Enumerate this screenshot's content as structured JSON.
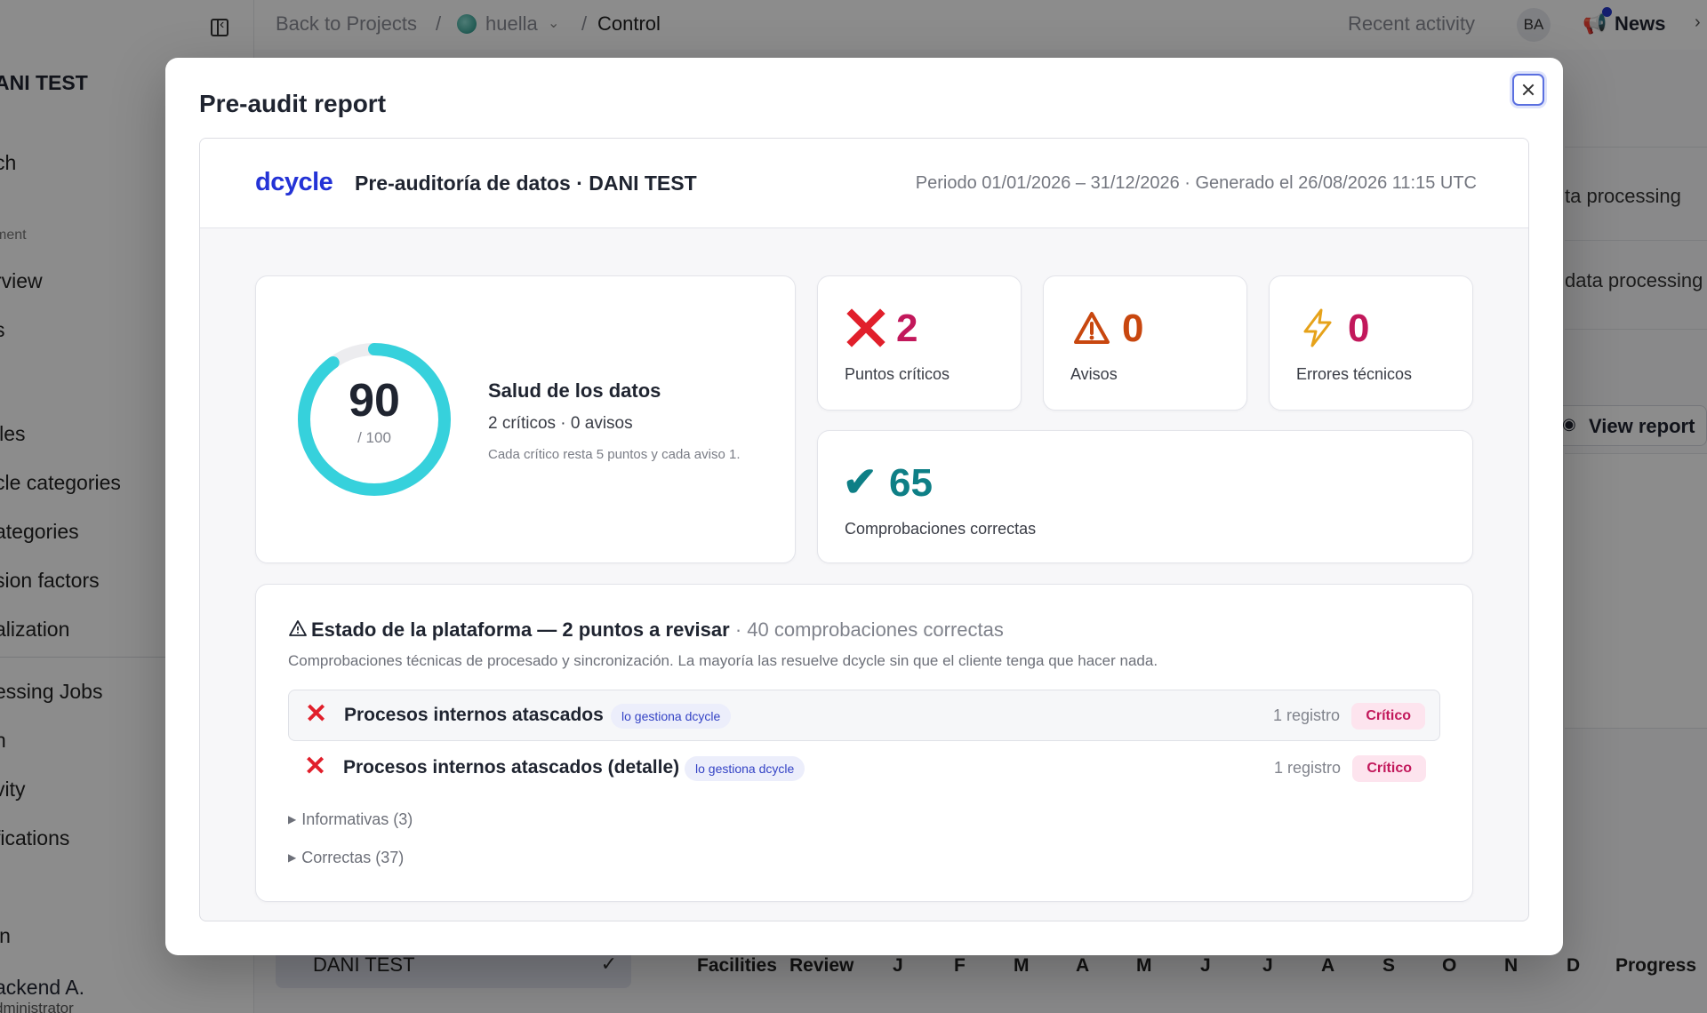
{
  "sidebar": {
    "org_title": "ANI TEST",
    "items_top": [
      {
        "label": "ch"
      }
    ],
    "section_label": "ment",
    "items_mid": [
      {
        "label": "rview"
      },
      {
        "label": "s"
      }
    ],
    "items_lists": [
      {
        "label": "iles"
      },
      {
        "label": "cle categories"
      },
      {
        "label": "ategories"
      },
      {
        "label": "sion factors"
      },
      {
        "label": "alization"
      }
    ],
    "items_bottom": [
      {
        "label": "essing Jobs"
      },
      {
        "label": "h"
      },
      {
        "label": "vity"
      },
      {
        "label": "fications"
      },
      {
        "label": "in"
      }
    ],
    "project": {
      "label": "DANI TEST"
    },
    "user": {
      "name": "ackend A.",
      "role": "dministrator"
    }
  },
  "topbar": {
    "back_label": "Back to Projects",
    "sep1": "/",
    "project_name": "huella",
    "sep2": "/",
    "current": "Control",
    "recent_activity": "Recent activity",
    "avatar_initials": "BA",
    "news_label": "News"
  },
  "background": {
    "row1": "ta processing",
    "row2": "data processing",
    "view_report": "View report",
    "table_headers": [
      "Facilities",
      "Review",
      "J",
      "F",
      "M",
      "A",
      "M",
      "J",
      "J",
      "A",
      "S",
      "O",
      "N",
      "D",
      "Progress"
    ]
  },
  "modal": {
    "title": "Pre-audit report",
    "report": {
      "brand": "dcycle",
      "title": "Pre-auditoría de datos · DANI TEST",
      "meta": "Periodo 01/01/2026 – 31/12/2026 · Generado el 26/08/2026 11:15 UTC",
      "health": {
        "score": "90",
        "score_max": "/ 100",
        "score_fraction": 0.9,
        "title": "Salud de los datos",
        "summary": "2 críticos · 0 avisos",
        "note": "Cada crítico resta 5 puntos y cada aviso 1."
      },
      "stats": {
        "critical": {
          "value": "2",
          "label": "Puntos críticos",
          "color": "#c2185b",
          "icon": "x-icon"
        },
        "warnings": {
          "value": "0",
          "label": "Avisos",
          "color": "#c8470f",
          "icon": "warning-icon"
        },
        "errors": {
          "value": "0",
          "label": "Errores técnicos",
          "color": "#c2185b",
          "icon": "lightning-icon"
        },
        "ok": {
          "value": "65",
          "label": "Comprobaciones correctas",
          "color": "#0e7f86",
          "icon": "check-icon"
        }
      },
      "platform": {
        "heading": "Estado de la plataforma — 2 puntos a revisar",
        "heading_extra": "· 40 comprobaciones correctas",
        "description": "Comprobaciones técnicas de procesado y sincronización. La mayoría las resuelve dcycle sin que el cliente tenga que hacer nada.",
        "issues": [
          {
            "name": "Procesos internos atascados",
            "tag": "lo gestiona dcycle",
            "count": "1 registro",
            "severity": "Crítico"
          },
          {
            "name": "Procesos internos atascados (detalle)",
            "tag": "lo gestiona dcycle",
            "count": "1 registro",
            "severity": "Crítico"
          }
        ],
        "toggles": [
          {
            "label": "Informativas (3)"
          },
          {
            "label": "Correctas (37)"
          }
        ]
      }
    }
  },
  "colors": {
    "brand": "#2433d6",
    "ring": "#36d1dc",
    "critical": "#e11f2b",
    "ok": "#0e7f86"
  }
}
